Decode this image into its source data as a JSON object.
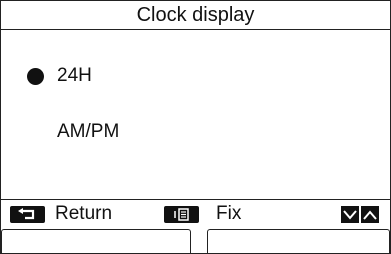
{
  "title": "Clock display",
  "options": [
    {
      "label": "24H",
      "selected": true
    },
    {
      "label": "AM/PM",
      "selected": false
    }
  ],
  "footer": {
    "return_label": "Return",
    "fix_label": "Fix",
    "return_icon": "return-arrow-icon",
    "fix_icon": "menu-icon",
    "nav_icons": [
      "chevron-down-icon",
      "chevron-up-icon"
    ]
  },
  "colors": {
    "foreground": "#111111",
    "background": "#ffffff"
  }
}
